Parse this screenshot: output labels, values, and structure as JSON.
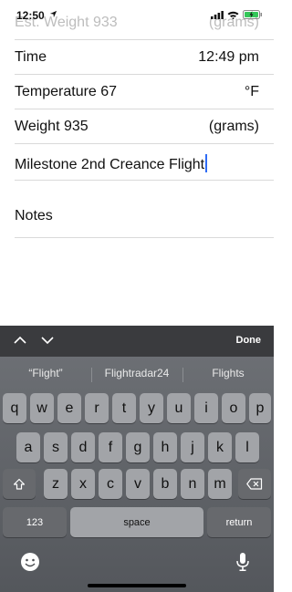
{
  "status_bar": {
    "time": "12:50"
  },
  "form": {
    "est_weight": {
      "label": "Est. Weight 933",
      "unit": "(grams)"
    },
    "time": {
      "label": "Time",
      "value": "12:49 pm"
    },
    "temperature": {
      "label": "Temperature 67",
      "unit": "°F"
    },
    "weight": {
      "label": "Weight 935",
      "unit": "(grams)"
    },
    "milestone": {
      "value": "Milestone 2nd Creance Flight"
    },
    "notes": {
      "label": "Notes"
    }
  },
  "keyboard": {
    "toolbar": {
      "done_label": "Done"
    },
    "suggestions": [
      "“Flight”",
      "Flightradar24",
      "Flights"
    ],
    "row1": [
      "q",
      "w",
      "e",
      "r",
      "t",
      "y",
      "u",
      "i",
      "o",
      "p"
    ],
    "row2": [
      "a",
      "s",
      "d",
      "f",
      "g",
      "h",
      "j",
      "k",
      "l"
    ],
    "row3": [
      "z",
      "x",
      "c",
      "v",
      "b",
      "n",
      "m"
    ],
    "numbers_label": "123",
    "space_label": "space",
    "return_label": "return"
  }
}
